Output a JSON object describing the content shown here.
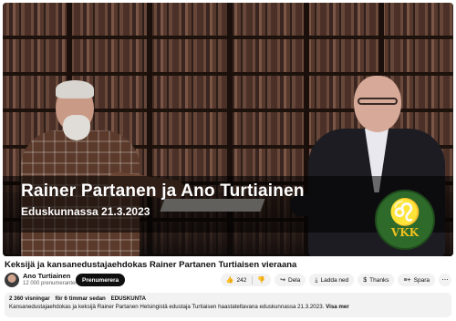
{
  "video": {
    "overlay_title": "Rainer Partanen ja Ano Turtiainen",
    "overlay_subtitle": "Eduskunnassa 21.3.2023",
    "logo_text": "VKK",
    "logo_icon": "lion-icon"
  },
  "title": "Keksijä ja kansanedustajaehdokas Rainer Partanen Turtiaisen vieraana",
  "channel": {
    "name": "Ano Turtiainen",
    "subscribers": "12 000 prenumeranter",
    "subscribe_label": "Prenumerera"
  },
  "actions": {
    "like_count": "242",
    "like_icon": "thumbs-up-icon",
    "dislike_icon": "thumbs-down-icon",
    "share_label": "Dela",
    "share_icon": "share-icon",
    "download_label": "Ladda ned",
    "download_icon": "download-icon",
    "thanks_label": "Thanks",
    "thanks_icon": "thanks-icon",
    "save_label": "Spara",
    "save_icon": "save-icon",
    "more_icon": "more-icon"
  },
  "description": {
    "views": "2 360 visningar",
    "age": "för 6 timmar sedan",
    "tag": "EDUSKUNTA",
    "text": "Kansanedustajaehdokas ja keksijä Rainer Partanen Helsingistä edustaja Turtiaisen haastateltavana eduskunnassa 21.3.2023.",
    "more_label": "Visa mer"
  },
  "colors": {
    "subscribe_bg": "#0f0f0f",
    "logo_green": "#2e6b2a",
    "logo_gold": "#f0c020"
  }
}
